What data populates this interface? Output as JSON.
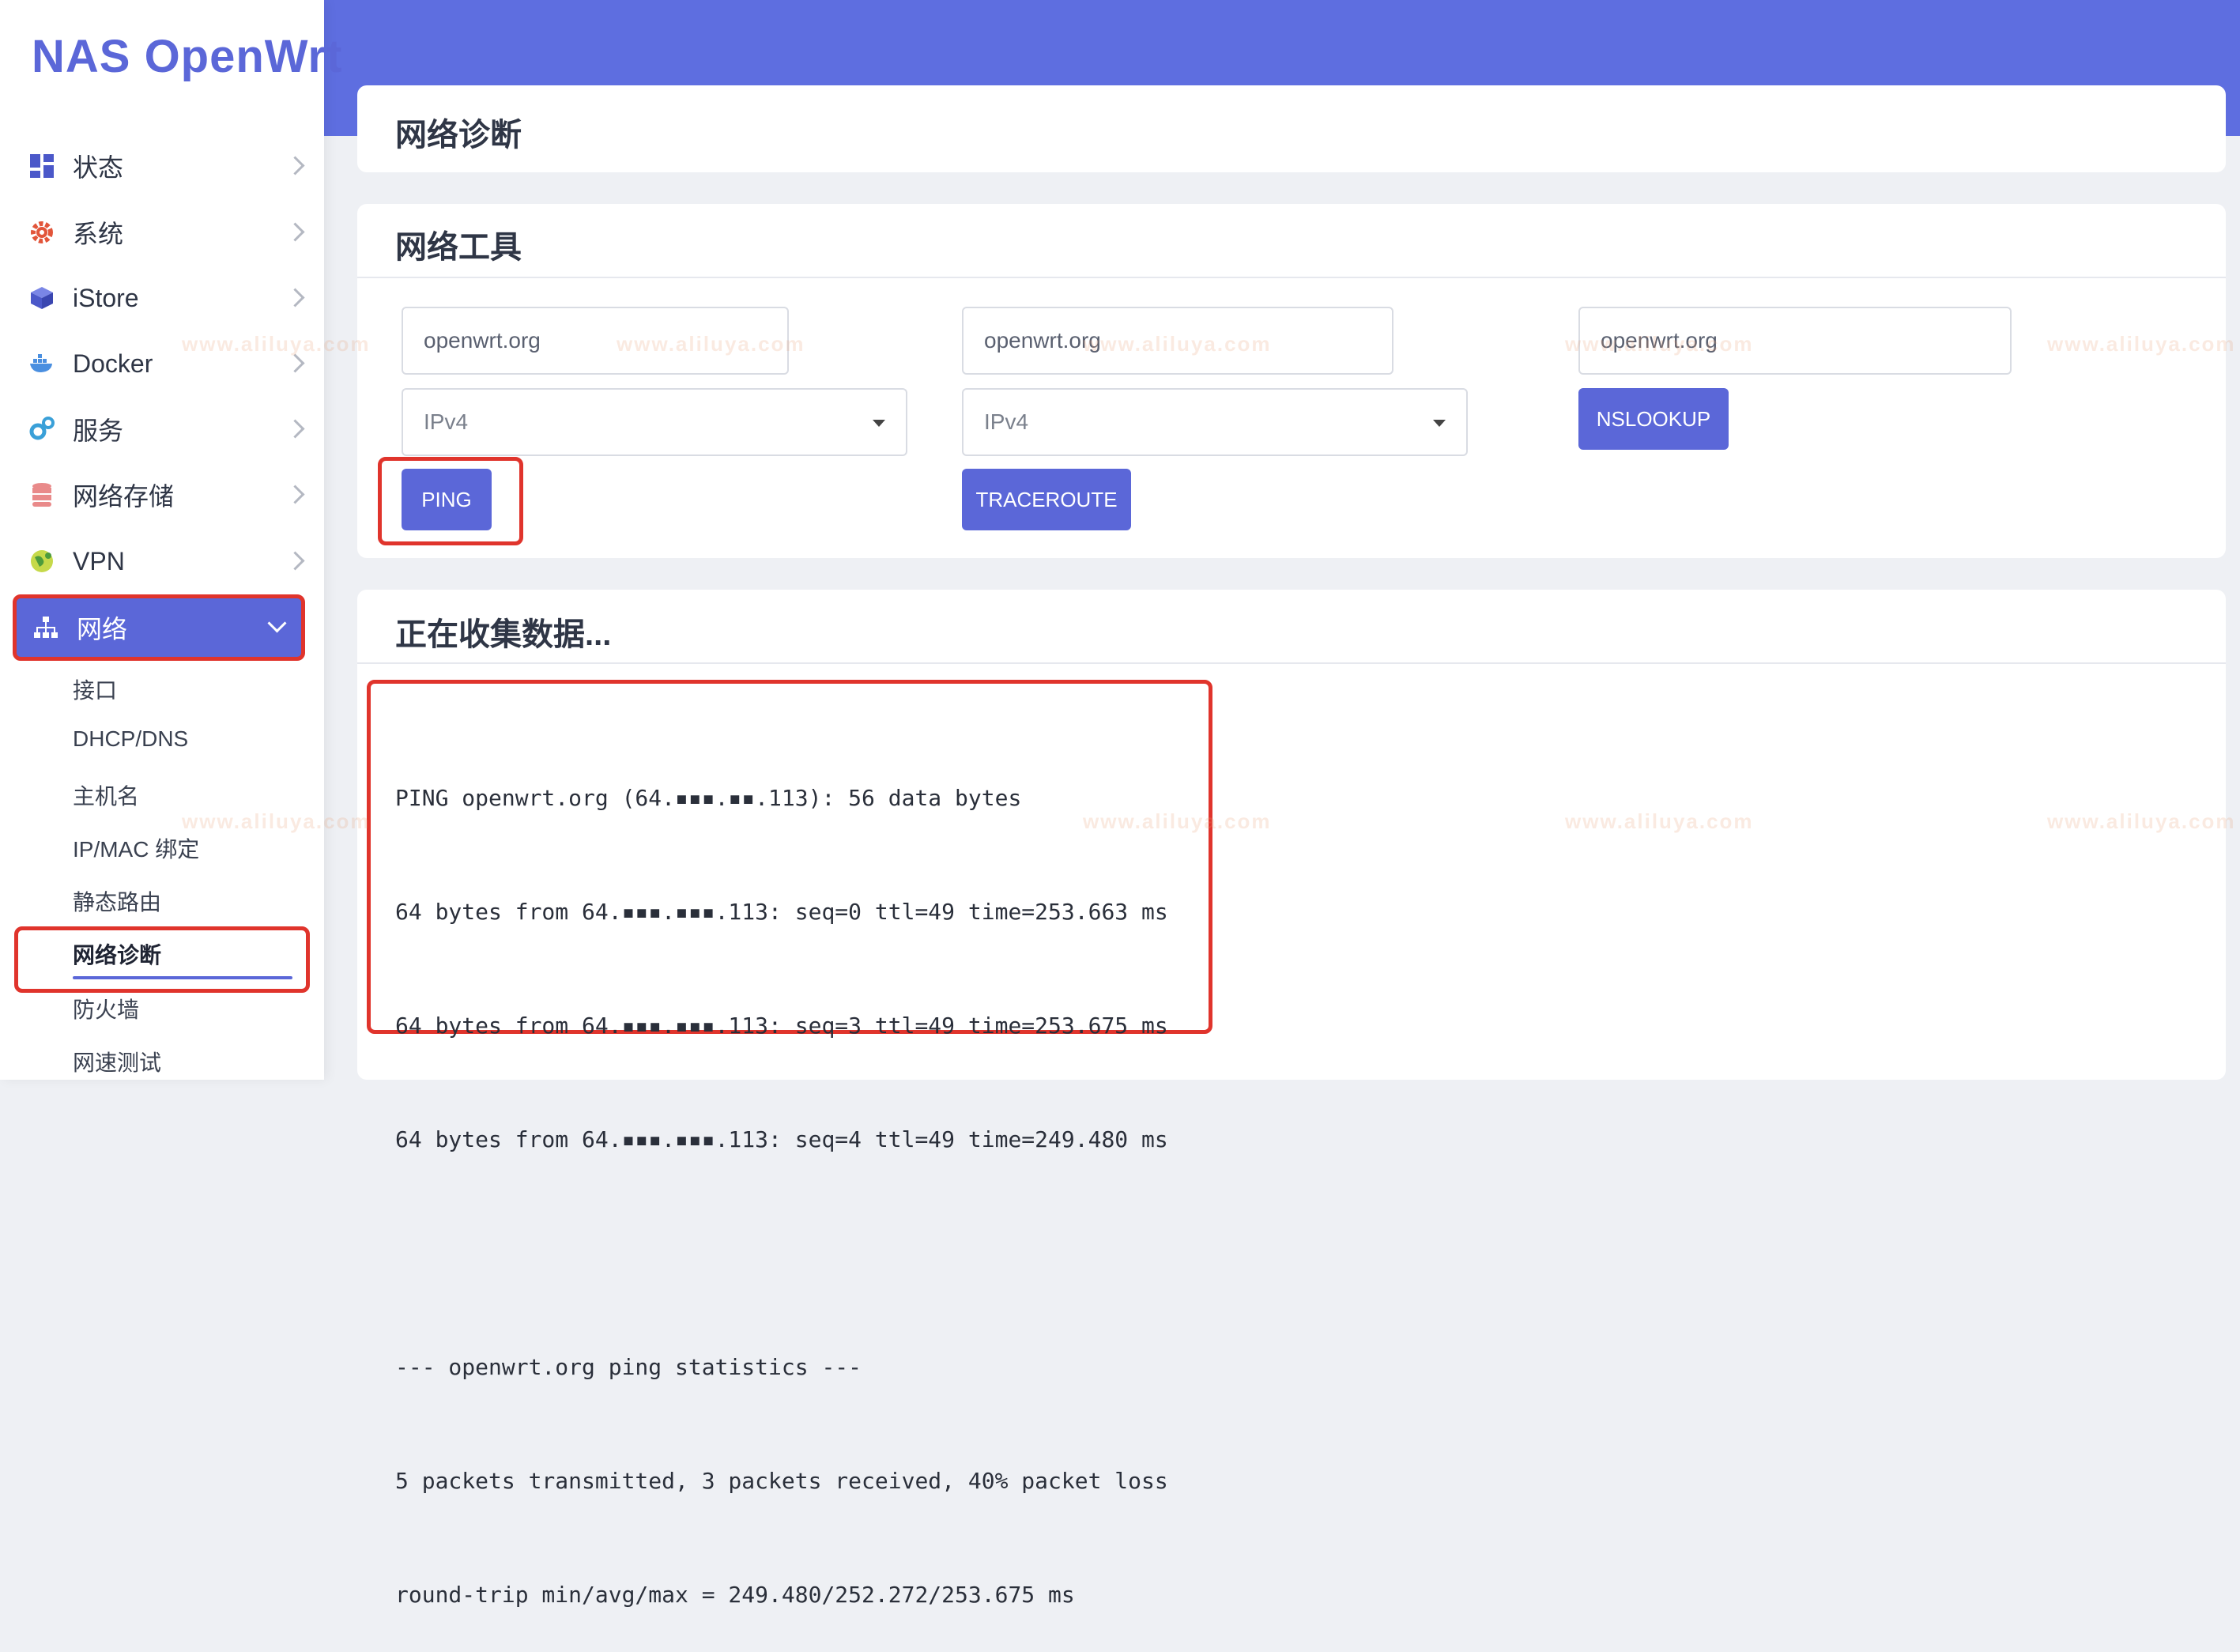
{
  "brand": "NAS OpenWrt",
  "sidebar": {
    "items": [
      {
        "label": "状态",
        "icon": "dashboard-icon"
      },
      {
        "label": "系统",
        "icon": "gear-icon"
      },
      {
        "label": "iStore",
        "icon": "cube-icon"
      },
      {
        "label": "Docker",
        "icon": "docker-icon"
      },
      {
        "label": "服务",
        "icon": "services-icon"
      },
      {
        "label": "网络存储",
        "icon": "database-icon"
      },
      {
        "label": "VPN",
        "icon": "globe-icon"
      },
      {
        "label": "网络",
        "icon": "network-icon"
      }
    ],
    "submenu": [
      "接口",
      "DHCP/DNS",
      "主机名",
      "IP/MAC 绑定",
      "静态路由",
      "网络诊断",
      "防火墙",
      "网速测试"
    ]
  },
  "page": {
    "title": "网络诊断"
  },
  "tools": {
    "title": "网络工具",
    "ping": {
      "host": "openwrt.org",
      "proto": "IPv4",
      "button": "PING"
    },
    "traceroute": {
      "host": "openwrt.org",
      "proto": "IPv4",
      "button": "TRACEROUTE"
    },
    "nslookup": {
      "host": "openwrt.org",
      "button": "NSLOOKUP"
    }
  },
  "results": {
    "title": "正在收集数据...",
    "lines": [
      "PING openwrt.org (64.▪▪▪.▪▪.113): 56 data bytes",
      "64 bytes from 64.▪▪▪.▪▪▪.113: seq=0 ttl=49 time=253.663 ms",
      "64 bytes from 64.▪▪▪.▪▪▪.113: seq=3 ttl=49 time=253.675 ms",
      "64 bytes from 64.▪▪▪.▪▪▪.113: seq=4 ttl=49 time=249.480 ms",
      "",
      "--- openwrt.org ping statistics ---",
      "5 packets transmitted, 3 packets received, 40% packet loss",
      "round-trip min/avg/max = 249.480/252.272/253.675 ms"
    ]
  },
  "watermark": "www.aliluya.com",
  "colors": {
    "accent": "#5b67d8",
    "highlight": "#e0342c",
    "topbar": "#5e6ee0"
  }
}
